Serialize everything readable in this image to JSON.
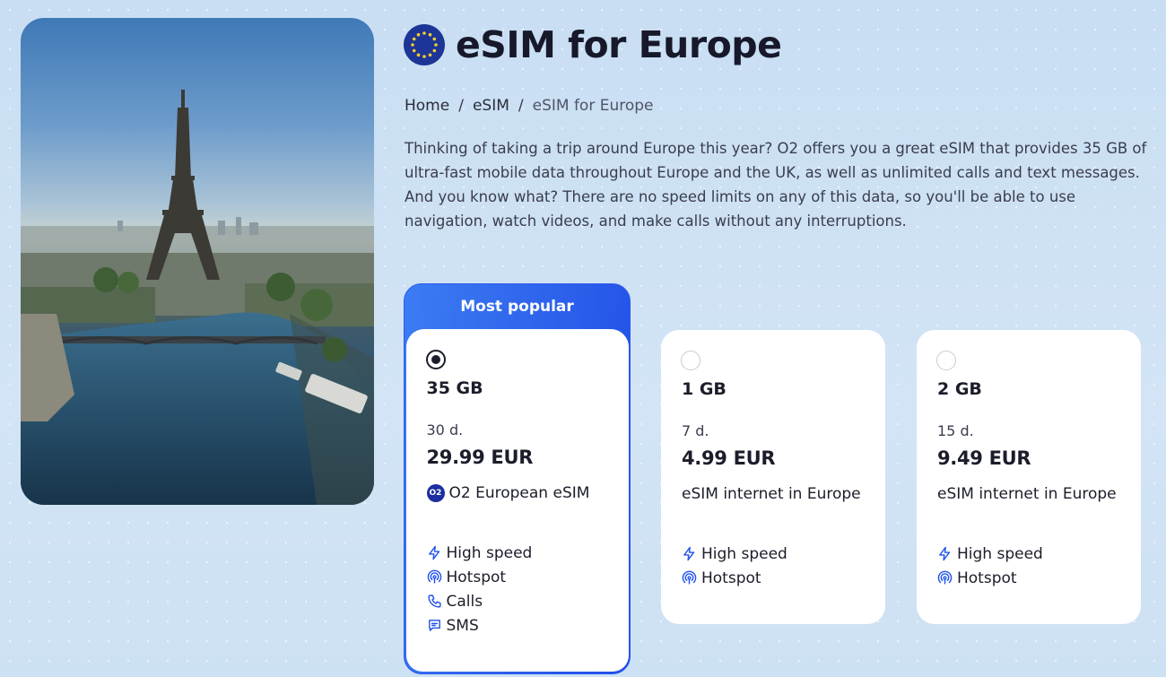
{
  "header": {
    "title": "eSIM for Europe",
    "flag_icon": "eu-flag-icon"
  },
  "breadcrumb": {
    "items": [
      "Home",
      "eSIM",
      "eSIM for Europe"
    ],
    "separator": "/"
  },
  "description": "Thinking of taking a trip around Europe this year? O2 offers you a great eSIM that provides 35 GB of ultra-fast mobile data throughout Europe and the UK, as well as unlimited calls and text messages. And you know what? There are no speed limits on any of this data, so you'll be able to use navigation, watch videos, and make calls without any interruptions.",
  "hero_image": "eiffel-tower-paris-photo",
  "badge": {
    "label": "Most popular"
  },
  "plans": [
    {
      "data": "35 GB",
      "duration": "30 d.",
      "price": "29.99 EUR",
      "name": "O2 European eSIM",
      "brand_badge": "O2",
      "selected": true,
      "features": [
        {
          "label": "High speed",
          "icon": "lightning-icon"
        },
        {
          "label": "Hotspot",
          "icon": "hotspot-icon"
        },
        {
          "label": "Calls",
          "icon": "phone-icon"
        },
        {
          "label": "SMS",
          "icon": "message-icon"
        }
      ]
    },
    {
      "data": "1 GB",
      "duration": "7 d.",
      "price": "4.99 EUR",
      "name": "eSIM internet in Europe",
      "selected": false,
      "features": [
        {
          "label": "High speed",
          "icon": "lightning-icon"
        },
        {
          "label": "Hotspot",
          "icon": "hotspot-icon"
        }
      ]
    },
    {
      "data": "2 GB",
      "duration": "15 d.",
      "price": "9.49 EUR",
      "name": "eSIM internet in Europe",
      "selected": false,
      "features": [
        {
          "label": "High speed",
          "icon": "lightning-icon"
        },
        {
          "label": "Hotspot",
          "icon": "hotspot-icon"
        }
      ]
    }
  ],
  "colors": {
    "accent": "#2152EA",
    "background": "#CFE2F4",
    "text": "#1B1D2A"
  }
}
